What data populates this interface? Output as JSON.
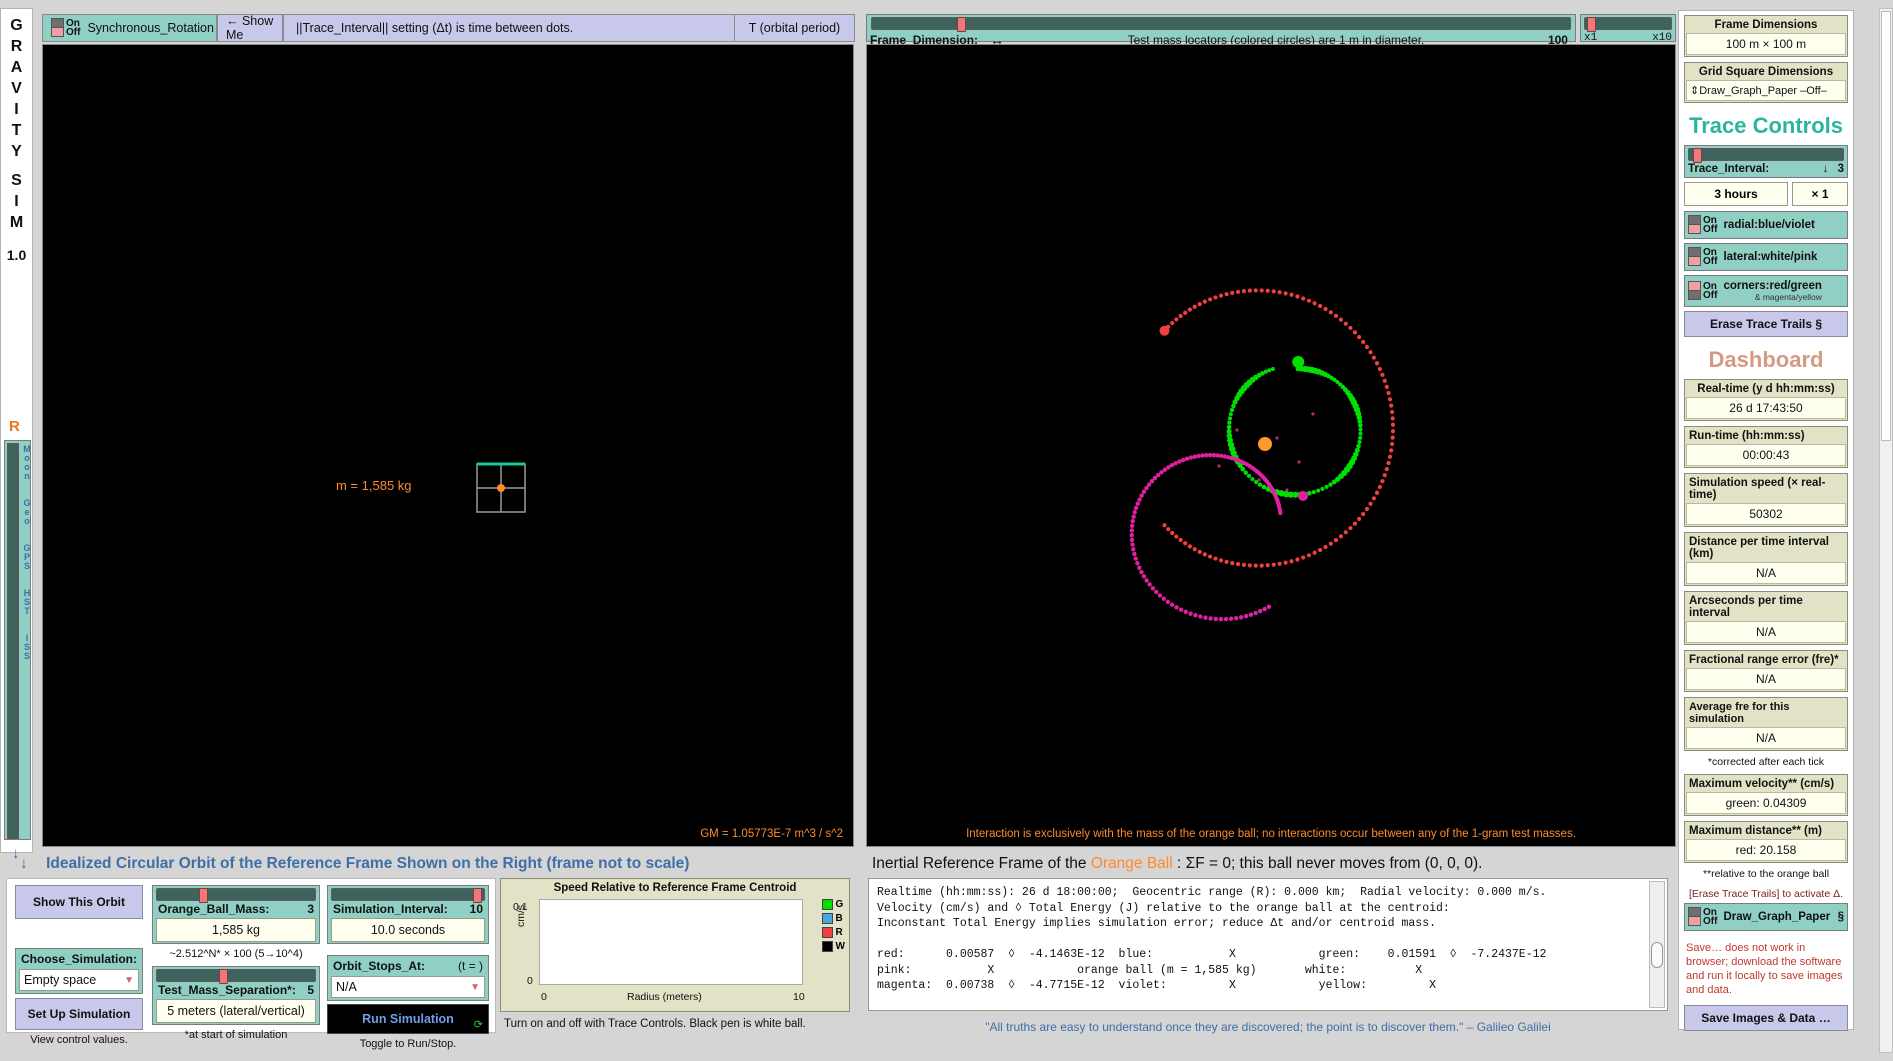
{
  "app": {
    "title_letters": [
      "G",
      "R",
      "A",
      "V",
      "I",
      "T",
      "Y",
      "",
      "S",
      "I",
      "M"
    ],
    "version": "1.0",
    "rail_marker": "R",
    "rail_slider_labels": [
      "Moon",
      "Geo",
      "GPS",
      "HST",
      "ISS"
    ]
  },
  "topbar_left": {
    "toggle_on": "On",
    "toggle_off": "Off",
    "toggle_label": "Synchronous_Rotation",
    "show_me": "← Show Me",
    "hint": "||Trace_Interval|| setting (Δt) is time between dots.",
    "period": "T (orbital period)"
  },
  "topbar_right": {
    "frame_dimension_label": "Frame_Dimension:",
    "frame_dimension_icon": "↔",
    "hint": "Test mass locators (colored circles) are 1 m in diameter.",
    "frame_value": "100",
    "zoom_min": "x1",
    "zoom_max": "x10"
  },
  "viewport_left": {
    "mass_label": "m = 1,585 kg",
    "footer": "GM = 1.05773E-7 m^3 / s^2"
  },
  "viewport_right": {
    "footer": "Interaction is exclusively with the mass of the orange ball; no interactions occur between any of the 1-gram test masses."
  },
  "right_panel": {
    "frame_dimensions_label": "Frame Dimensions",
    "frame_dimensions_value": "100 m × 100 m",
    "grid_square_label": "Grid Square Dimensions",
    "grid_square_value": "⇕Draw_Graph_Paper –Off–",
    "trace_controls_heading": "Trace Controls",
    "trace_interval_label": "Trace_Interval:",
    "trace_interval_arrow": "↓",
    "trace_interval_number": "3",
    "trace_interval_value": "3 hours",
    "trace_interval_mult": "× 1",
    "toggles": [
      {
        "on": "On",
        "off": "Off",
        "label": "radial:blue/violet",
        "sub": "",
        "state": "off"
      },
      {
        "on": "On",
        "off": "Off",
        "label": "lateral:white/pink",
        "sub": "",
        "state": "off"
      },
      {
        "on": "On",
        "off": "Off",
        "label": "corners:red/green",
        "sub": "& magenta/yellow",
        "state": "on"
      }
    ],
    "erase_button": "Erase Trace Trails   §",
    "dashboard_heading": "Dashboard",
    "dashboard_items": [
      {
        "label": "Real-time (y d hh:mm:ss)",
        "value": "26 d 17:43:50"
      },
      {
        "label": "Run-time (hh:mm:ss)",
        "value": "00:00:43"
      },
      {
        "label": "Simulation speed (× real-time)",
        "value": "50302"
      },
      {
        "label": "Distance per time interval (km)",
        "value": "N/A"
      },
      {
        "label": "Arcseconds per time interval",
        "value": "N/A"
      },
      {
        "label": "Fractional range error (fre)*",
        "value": "N/A"
      },
      {
        "label": "Average fre for this simulation",
        "value": "N/A"
      }
    ],
    "note_corrected": "*corrected after each tick",
    "max_items": [
      {
        "label": "Maximum velocity** (cm/s)",
        "value": "green: 0.04309"
      },
      {
        "label": "Maximum distance** (m)",
        "value": "red: 20.158"
      }
    ],
    "note_relative": "**relative to the orange ball",
    "erase_hint": "[Erase Trace Trails] to activate Δ.",
    "graph_paper_on": "On",
    "graph_paper_off": "Off",
    "graph_paper_label": "Draw_Graph_Paper",
    "graph_paper_sect": "§",
    "save_warning": "Save… does not work in browser; download the software and run it locally to save images and data.",
    "save_button": "Save Images & Data …"
  },
  "bottom": {
    "title_left": "Idealized Circular Orbit of the Reference Frame Shown on the Right (frame not to scale)",
    "title_left_arrow": "↓",
    "title_right_pre": "Inertial Reference Frame of the ",
    "title_right_accent": "Orange Ball",
    "title_right_post": " : ΣF = 0; this ball never moves from (0, 0, 0).",
    "show_orbit_button": "Show This Orbit",
    "choose_sim_label": "Choose_Simulation:",
    "choose_sim_value": "Empty space",
    "setup_button": "Set Up Simulation",
    "view_note": "View control values.",
    "orange_mass_label": "Orange_Ball_Mass:",
    "orange_mass_ticks": "3",
    "orange_mass_value": "1,585 kg",
    "orange_mass_note": "~2.512^N* × 100   (5→10^4)",
    "test_sep_label": "Test_Mass_Separation*:",
    "test_sep_ticks": "5",
    "test_sep_value": "5 meters (lateral/vertical)",
    "test_sep_note": "*at start of simulation",
    "sim_interval_label": "Simulation_Interval:",
    "sim_interval_ticks": "10",
    "sim_interval_value": "10.0 seconds",
    "orbit_stops_label": "Orbit_Stops_At:",
    "orbit_stops_t": "(t = )",
    "orbit_stops_value": "N/A",
    "run_button": "Run Simulation",
    "run_note": "Toggle to Run/Stop.",
    "chart_note": "Turn on and off with Trace Controls. Black pen is white ball.",
    "quote": "\"All truths are easy to understand once they are discovered; the point is to discover them.\" – Galileo Galilei"
  },
  "console": {
    "lines": "Realtime (hh:mm:ss): 26 d 18:00:00;  Geocentric range (R): 0.000 km;  Radial velocity: 0.000 m/s.\nVelocity (cm/s) and ◊ Total Energy (J) relative to the orange ball at the centroid:\nInconstant Total Energy implies simulation error; reduce Δt and/or centroid mass.\n\nred:      0.00587  ◊  -4.1463E-12  blue:           X            green:    0.01591  ◊  -7.2437E-12\npink:           X            orange ball (m = 1,585 kg)       white:          X\nmagenta:  0.00738  ◊  -4.7715E-12  violet:         X            yellow:         X"
  },
  "chart_data": {
    "type": "line",
    "title": "Speed Relative to Reference Frame Centroid",
    "xlabel": "Radius (meters)",
    "ylabel": "cm/s",
    "xlim": [
      0,
      10
    ],
    "ylim": [
      0,
      0.1
    ],
    "xticks": [
      "0",
      "10"
    ],
    "yticks": [
      "0",
      "0.1"
    ],
    "grid": false,
    "legend_position": "right",
    "series": [
      {
        "name": "G",
        "color": "#00e000",
        "values": []
      },
      {
        "name": "B",
        "color": "#4aa8e0",
        "values": []
      },
      {
        "name": "R",
        "color": "#f04040",
        "values": []
      },
      {
        "name": "W",
        "color": "#000000",
        "values": []
      }
    ]
  },
  "colors": {
    "accent_orange": "#ff8a2b",
    "accent_blue": "#3f6ea8",
    "teal": "#8fcfc4",
    "lavender": "#c8c8ea",
    "khaki": "#e2e2c6",
    "trace_green": "#00e000",
    "trace_red": "#f04040",
    "trace_magenta": "#e020a0"
  }
}
